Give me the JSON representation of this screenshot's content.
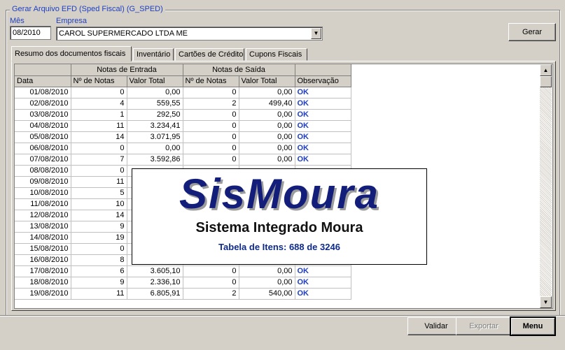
{
  "window": {
    "group_title": "Gerar Arquivo EFD (Sped Fiscal) (G_SPED)"
  },
  "form": {
    "mes_label": "Mês",
    "mes_value": "08/2010",
    "empresa_label": "Empresa",
    "empresa_value": "CAROL SUPERMERCADO LTDA ME",
    "gerar_button": "Gerar"
  },
  "tabs": [
    {
      "label": "Resumo dos documentos fiscais",
      "active": true
    },
    {
      "label": "Inventário",
      "active": false
    },
    {
      "label": "Cartões de Crédito",
      "active": false
    },
    {
      "label": "Cupons Fiscais",
      "active": false
    }
  ],
  "grid": {
    "group_headers": {
      "entrada": "Notas de Entrada",
      "saida": "Notas de Saída"
    },
    "columns": [
      "Data",
      "Nº de Notas",
      "Valor Total",
      "Nº de Notas",
      "Valor Total",
      "Observação"
    ],
    "rows": [
      [
        "01/08/2010",
        "0",
        "0,00",
        "0",
        "0,00",
        "OK"
      ],
      [
        "02/08/2010",
        "4",
        "559,55",
        "2",
        "499,40",
        "OK"
      ],
      [
        "03/08/2010",
        "1",
        "292,50",
        "0",
        "0,00",
        "OK"
      ],
      [
        "04/08/2010",
        "11",
        "3.234,41",
        "0",
        "0,00",
        "OK"
      ],
      [
        "05/08/2010",
        "14",
        "3.071,95",
        "0",
        "0,00",
        "OK"
      ],
      [
        "06/08/2010",
        "0",
        "0,00",
        "0",
        "0,00",
        "OK"
      ],
      [
        "07/08/2010",
        "7",
        "3.592,86",
        "0",
        "0,00",
        "OK"
      ],
      [
        "08/08/2010",
        "0",
        "",
        "",
        "",
        ""
      ],
      [
        "09/08/2010",
        "11",
        "",
        "",
        "",
        ""
      ],
      [
        "10/08/2010",
        "5",
        "",
        "",
        "",
        ""
      ],
      [
        "11/08/2010",
        "10",
        "",
        "",
        "",
        ""
      ],
      [
        "12/08/2010",
        "14",
        "",
        "",
        "",
        ""
      ],
      [
        "13/08/2010",
        "9",
        "",
        "",
        "",
        ""
      ],
      [
        "14/08/2010",
        "19",
        "",
        "",
        "",
        ""
      ],
      [
        "15/08/2010",
        "0",
        "",
        "",
        "",
        ""
      ],
      [
        "16/08/2010",
        "8",
        "2.750,05",
        "1",
        "59,92",
        "OK"
      ],
      [
        "17/08/2010",
        "6",
        "3.605,10",
        "0",
        "0,00",
        "OK"
      ],
      [
        "18/08/2010",
        "9",
        "2.336,10",
        "0",
        "0,00",
        "OK"
      ],
      [
        "19/08/2010",
        "11",
        "6.805,91",
        "2",
        "540,00",
        "OK"
      ]
    ]
  },
  "splash": {
    "logo_text": "SisMoura",
    "subtitle": "Sistema Integrado Moura",
    "status": "Tabela de Itens: 688 de 3246"
  },
  "buttons": {
    "validar": "Validar",
    "exportar": "Exportar",
    "menu": "Menu"
  },
  "colors": {
    "label_blue": "#1f3fbf",
    "logo_navy": "#121e7a",
    "ok_blue": "#1f3fbf",
    "window_bg": "#d4d0c8"
  }
}
